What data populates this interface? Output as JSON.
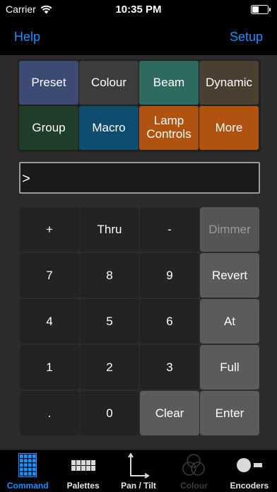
{
  "status_bar": {
    "carrier": "Carrier",
    "time": "10:35 PM"
  },
  "nav": {
    "left_label": "Help",
    "right_label": "Setup"
  },
  "groups": [
    {
      "label": "Preset",
      "color": "#3d4a73"
    },
    {
      "label": "Colour",
      "color": "#3c3c3c"
    },
    {
      "label": "Beam",
      "color": "#2e6b5e"
    },
    {
      "label": "Dynamic",
      "color": "#4a4032"
    },
    {
      "label": "Group",
      "color": "#203d29"
    },
    {
      "label": "Macro",
      "color": "#0e4d70"
    },
    {
      "label": "Lamp\nControls",
      "color": "#b05210"
    },
    {
      "label": "More",
      "color": "#b05210"
    }
  ],
  "command_line": {
    "text": ">"
  },
  "keypad": [
    {
      "label": "+",
      "type": "num"
    },
    {
      "label": "Thru",
      "type": "num"
    },
    {
      "label": "-",
      "type": "num"
    },
    {
      "label": "Dimmer",
      "type": "fn-disabled"
    },
    {
      "label": "7",
      "type": "num"
    },
    {
      "label": "8",
      "type": "num"
    },
    {
      "label": "9",
      "type": "num"
    },
    {
      "label": "Revert",
      "type": "fn"
    },
    {
      "label": "4",
      "type": "num"
    },
    {
      "label": "5",
      "type": "num"
    },
    {
      "label": "6",
      "type": "num"
    },
    {
      "label": "At",
      "type": "fn"
    },
    {
      "label": "1",
      "type": "num"
    },
    {
      "label": "2",
      "type": "num"
    },
    {
      "label": "3",
      "type": "num"
    },
    {
      "label": "Full",
      "type": "fn"
    },
    {
      "label": ".",
      "type": "num"
    },
    {
      "label": "0",
      "type": "num"
    },
    {
      "label": "Clear",
      "type": "fn"
    },
    {
      "label": "Enter",
      "type": "fn"
    }
  ],
  "tabs": [
    {
      "label": "Command",
      "icon": "keypad-grid-icon",
      "state": "active"
    },
    {
      "label": "Palettes",
      "icon": "palettes-grid-icon",
      "state": "normal"
    },
    {
      "label": "Pan / Tilt",
      "icon": "pan-tilt-axes-icon",
      "state": "normal"
    },
    {
      "label": "Colour",
      "icon": "colour-circles-icon",
      "state": "disabled"
    },
    {
      "label": "Encoders",
      "icon": "encoders-icon",
      "state": "normal"
    }
  ],
  "colors": {
    "accent": "#1f8fff",
    "background": "#2b2b2b"
  }
}
